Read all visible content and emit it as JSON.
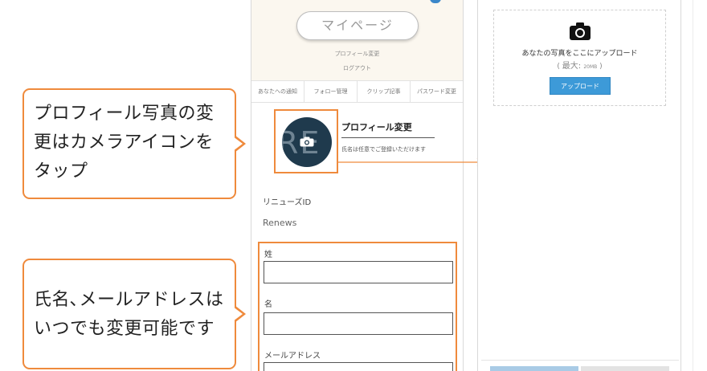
{
  "callouts": {
    "profile_photo": "プロフィール写真の変更はカメラアイコンをタップ",
    "name_email": "氏名､メールアドレスはいつでも変更可能です"
  },
  "header": {
    "mypage_button": "マイページ",
    "profile_edit_link": "プロフィール変更",
    "logout_link": "ログアウト"
  },
  "tabs": [
    {
      "label": "あなたへの通知"
    },
    {
      "label": "フォロー管理"
    },
    {
      "label": "クリップ記事"
    },
    {
      "label": "パスワード変更"
    }
  ],
  "profile": {
    "avatar_text": "RE",
    "title": "プロフィール変更",
    "note": "氏名は任意でご登録いただけます",
    "id_label": "リニューズID",
    "id_value": "Renews"
  },
  "form": {
    "last_name_label": "姓",
    "last_name_value": "",
    "first_name_label": "名",
    "first_name_value": "",
    "email_label": "メールアドレス",
    "email_value": ""
  },
  "upload": {
    "dropzone_text": "あなたの写真をここにアップロード",
    "max_open": "( ",
    "max_label": "最大: ",
    "max_size": "20MB",
    "max_close": " )",
    "button_label": "アップロード"
  },
  "colors": {
    "accent_orange": "#ef8a3c",
    "header_bg": "#fbf7ef",
    "upload_blue": "#3d9ad8",
    "avatar_bg": "#1f3a4d"
  }
}
